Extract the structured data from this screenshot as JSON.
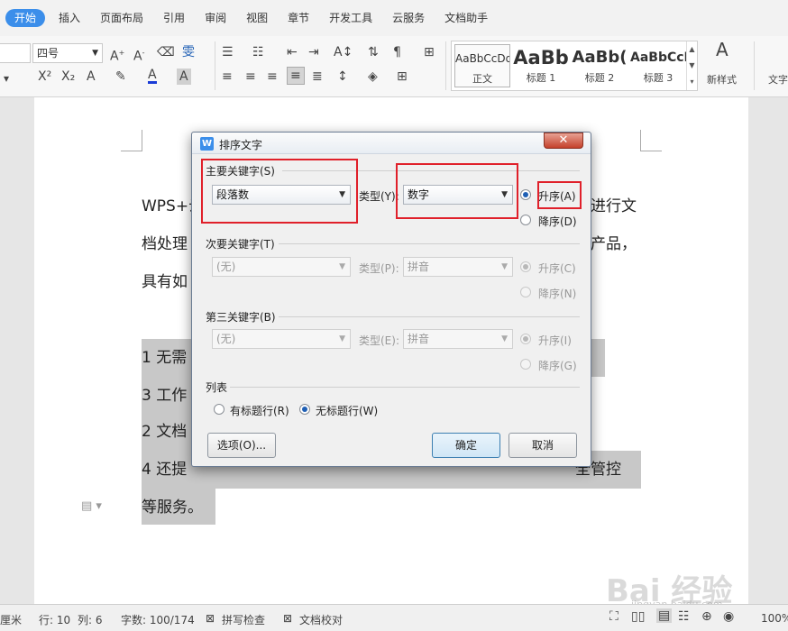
{
  "menubar": {
    "tabs": [
      "开始",
      "插入",
      "页面布局",
      "引用",
      "审阅",
      "视图",
      "章节",
      "开发工具",
      "云服务",
      "文档助手"
    ]
  },
  "ribbon": {
    "font_size": "四号",
    "styles": [
      {
        "sample": "AaBbCcDd",
        "label": "正文"
      },
      {
        "sample": "AaBb",
        "label": "标题 1"
      },
      {
        "sample": "AaBb(",
        "label": "标题 2"
      },
      {
        "sample": "AaBbCcI",
        "label": "标题 3"
      }
    ],
    "new_style_label": "新样式",
    "text_tools_label": "文字"
  },
  "document": {
    "lines": [
      {
        "left": "WPS+云",
        "right": "进行文"
      },
      {
        "left": "档处理",
        "right": "产品，"
      },
      {
        "left": "具有如",
        "right": ""
      },
      {
        "left": "1 无需",
        "right": ""
      },
      {
        "left": "3 工作",
        "right": ""
      },
      {
        "left": "2 文档",
        "right": ""
      },
      {
        "left": "4 还提",
        "right": "全管控"
      },
      {
        "left": "等服务。",
        "right": ""
      }
    ]
  },
  "dialog": {
    "title": "排序文字",
    "primary": {
      "group_label": "主要关键字(S)",
      "field": "段落数",
      "type_label": "类型(Y):",
      "type": "数字",
      "asc": "升序(A)",
      "desc": "降序(D)"
    },
    "secondary": {
      "group_label": "次要关键字(T)",
      "field": "(无)",
      "type_label": "类型(P):",
      "type": "拼音",
      "asc": "升序(C)",
      "desc": "降序(N)"
    },
    "tertiary": {
      "group_label": "第三关键字(B)",
      "field": "(无)",
      "type_label": "类型(E):",
      "type": "拼音",
      "asc": "升序(I)",
      "desc": "降序(G)"
    },
    "list": {
      "group_label": "列表",
      "has_header": "有标题行(R)",
      "no_header": "无标题行(W)"
    },
    "options_button": "选项(O)...",
    "ok_button": "确定",
    "cancel_button": "取消"
  },
  "statusbar": {
    "unit": "厘米",
    "row": "行: 10",
    "col": "列: 6",
    "word_count": "字数: 100/174",
    "spell_check": "拼写检查",
    "doc_check": "文档校对",
    "zoom": "100%"
  },
  "watermark": {
    "brand": "Bai 经验",
    "url": "jingyan.baidu.com"
  },
  "colors": {
    "accent": "#3b8eea",
    "highlight_box": "#e0202a"
  }
}
